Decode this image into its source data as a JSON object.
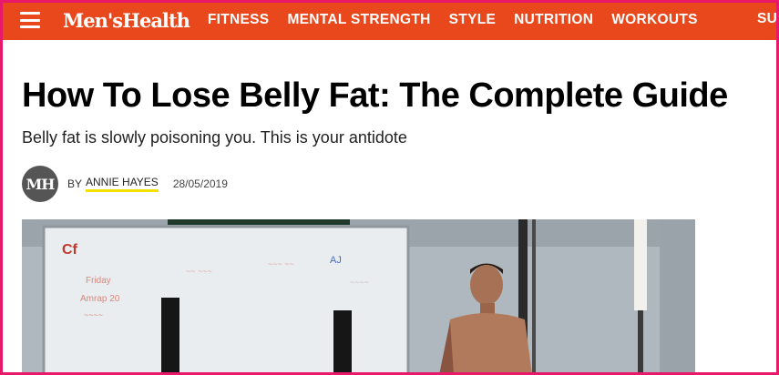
{
  "brand": {
    "logo_text": "Men'sHealth"
  },
  "nav": {
    "items": [
      "FITNESS",
      "MENTAL STRENGTH",
      "STYLE",
      "NUTRITION",
      "WORKOUTS"
    ],
    "overflow_partial": "SU"
  },
  "article": {
    "title": "How To Lose Belly Fat: The Complete Guide",
    "dek": "Belly fat is slowly poisoning you. This is your antidote",
    "byline": {
      "avatar_text": "MH",
      "prefix": "BY",
      "author": "ANNIE HAYES",
      "date": "28/05/2019"
    }
  },
  "colors": {
    "nav_bg": "#e8481b",
    "frame": "#e8196b",
    "author_underline": "#f2e200"
  }
}
